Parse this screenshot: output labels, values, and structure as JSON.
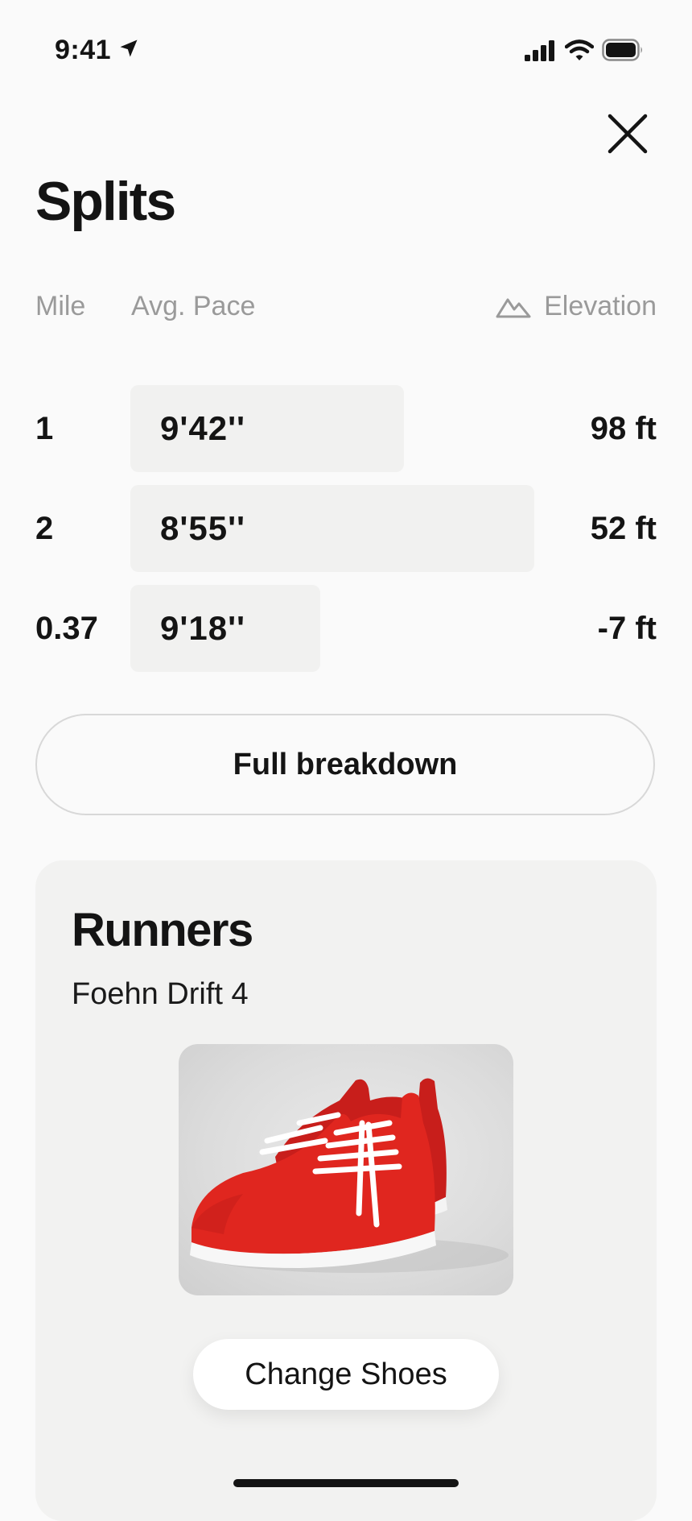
{
  "status_bar": {
    "time": "9:41",
    "icons": [
      "location-arrow-icon",
      "cellular-signal-icon",
      "wifi-icon",
      "battery-icon"
    ]
  },
  "header": {
    "title": "Splits",
    "close_icon": "close-icon"
  },
  "splits": {
    "columns": {
      "mile": "Mile",
      "pace": "Avg. Pace",
      "elevation": "Elevation",
      "elevation_icon": "mountain-icon"
    },
    "rows": [
      {
        "mile": "1",
        "pace": "9'42''",
        "elevation": "98 ft"
      },
      {
        "mile": "2",
        "pace": "8'55''",
        "elevation": "52 ft"
      },
      {
        "mile": "0.37",
        "pace": "9'18''",
        "elevation": "-7 ft"
      }
    ],
    "full_breakdown_label": "Full breakdown"
  },
  "runners": {
    "title": "Runners",
    "shoe_name": "Foehn Drift 4",
    "shoe_color": "#d8231f",
    "change_button_label": "Change Shoes"
  },
  "colors": {
    "background": "#fafafa",
    "card": "#f2f2f1",
    "pace_bar": "#f1f1f0",
    "muted_text": "#9a9a9a",
    "text": "#141414"
  }
}
